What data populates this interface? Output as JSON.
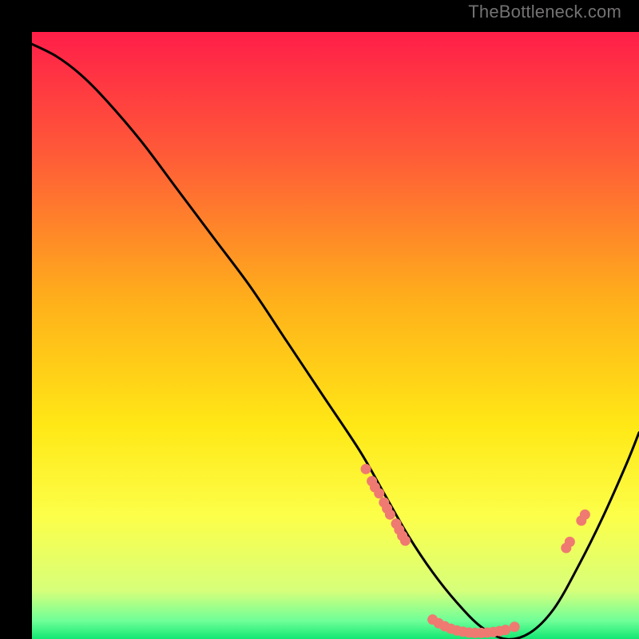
{
  "watermark": "TheBottleneck.com",
  "chart_data": {
    "type": "line",
    "title": "",
    "xlabel": "",
    "ylabel": "",
    "xlim": [
      0,
      100
    ],
    "ylim": [
      0,
      100
    ],
    "gradient_stops": [
      {
        "offset": 0,
        "color": "#ff1e49"
      },
      {
        "offset": 20,
        "color": "#ff5a38"
      },
      {
        "offset": 45,
        "color": "#ffb21a"
      },
      {
        "offset": 65,
        "color": "#ffe816"
      },
      {
        "offset": 80,
        "color": "#fcff4a"
      },
      {
        "offset": 92,
        "color": "#d7ff7a"
      },
      {
        "offset": 97,
        "color": "#6fff98"
      },
      {
        "offset": 100,
        "color": "#12e873"
      }
    ],
    "series": [
      {
        "name": "bottleneck-curve",
        "x": [
          0,
          4,
          8,
          12,
          18,
          24,
          30,
          36,
          42,
          48,
          54,
          58,
          62,
          66,
          70,
          74,
          78,
          82,
          86,
          90,
          94,
          98,
          100
        ],
        "y": [
          98,
          96,
          93,
          89,
          82,
          74,
          66,
          58,
          49,
          40,
          31,
          24,
          17,
          11,
          6,
          2,
          0,
          1,
          5,
          12,
          20,
          29,
          34
        ]
      }
    ],
    "highlight_clusters": [
      {
        "name": "left-slope-cluster",
        "points": [
          {
            "x": 55,
            "y": 28
          },
          {
            "x": 56,
            "y": 26
          },
          {
            "x": 56.5,
            "y": 25
          },
          {
            "x": 57.2,
            "y": 24
          },
          {
            "x": 58,
            "y": 22.5
          },
          {
            "x": 58.5,
            "y": 21.5
          },
          {
            "x": 59,
            "y": 20.5
          },
          {
            "x": 60,
            "y": 19
          },
          {
            "x": 60.5,
            "y": 18
          },
          {
            "x": 61,
            "y": 17
          },
          {
            "x": 61.5,
            "y": 16.2
          }
        ]
      },
      {
        "name": "bottom-flat-cluster",
        "points": [
          {
            "x": 66,
            "y": 3.2
          },
          {
            "x": 67,
            "y": 2.6
          },
          {
            "x": 68,
            "y": 2.1
          },
          {
            "x": 69,
            "y": 1.7
          },
          {
            "x": 70,
            "y": 1.4
          },
          {
            "x": 71,
            "y": 1.2
          },
          {
            "x": 72,
            "y": 1.05
          },
          {
            "x": 73,
            "y": 1.0
          },
          {
            "x": 74,
            "y": 1.0
          },
          {
            "x": 75,
            "y": 1.05
          },
          {
            "x": 76,
            "y": 1.15
          },
          {
            "x": 77,
            "y": 1.3
          },
          {
            "x": 78,
            "y": 1.5
          },
          {
            "x": 79.5,
            "y": 2.0
          }
        ]
      },
      {
        "name": "right-slope-cluster",
        "points": [
          {
            "x": 88,
            "y": 15
          },
          {
            "x": 88.6,
            "y": 16
          },
          {
            "x": 90.5,
            "y": 19.5
          },
          {
            "x": 91.1,
            "y": 20.5
          }
        ]
      }
    ],
    "highlight_color": "#ef7a71",
    "curve_color": "#000000"
  }
}
